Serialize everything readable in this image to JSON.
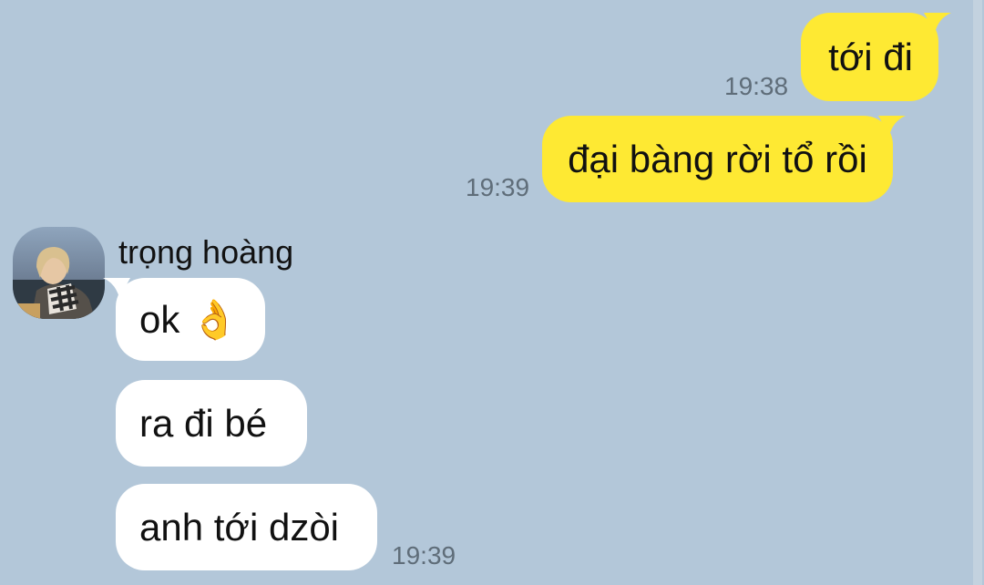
{
  "chat": {
    "messages": [
      {
        "direction": "out",
        "text": "tới đi",
        "time": "19:38"
      },
      {
        "direction": "out",
        "text": "đại bàng rời tổ rồi",
        "time": "19:39"
      },
      {
        "direction": "in",
        "text": "ok 👌",
        "sender": "trọng hoàng"
      },
      {
        "direction": "in",
        "text": "ra đi bé"
      },
      {
        "direction": "in",
        "text": "anh tới dzòi",
        "time": "19:39"
      }
    ]
  },
  "colors": {
    "background": "#b3c7d9",
    "outgoing_bubble": "#fee933",
    "incoming_bubble": "#ffffff",
    "timestamp": "#5f6d79"
  },
  "icons": {
    "ok_hand": "ok-hand-emoji"
  }
}
